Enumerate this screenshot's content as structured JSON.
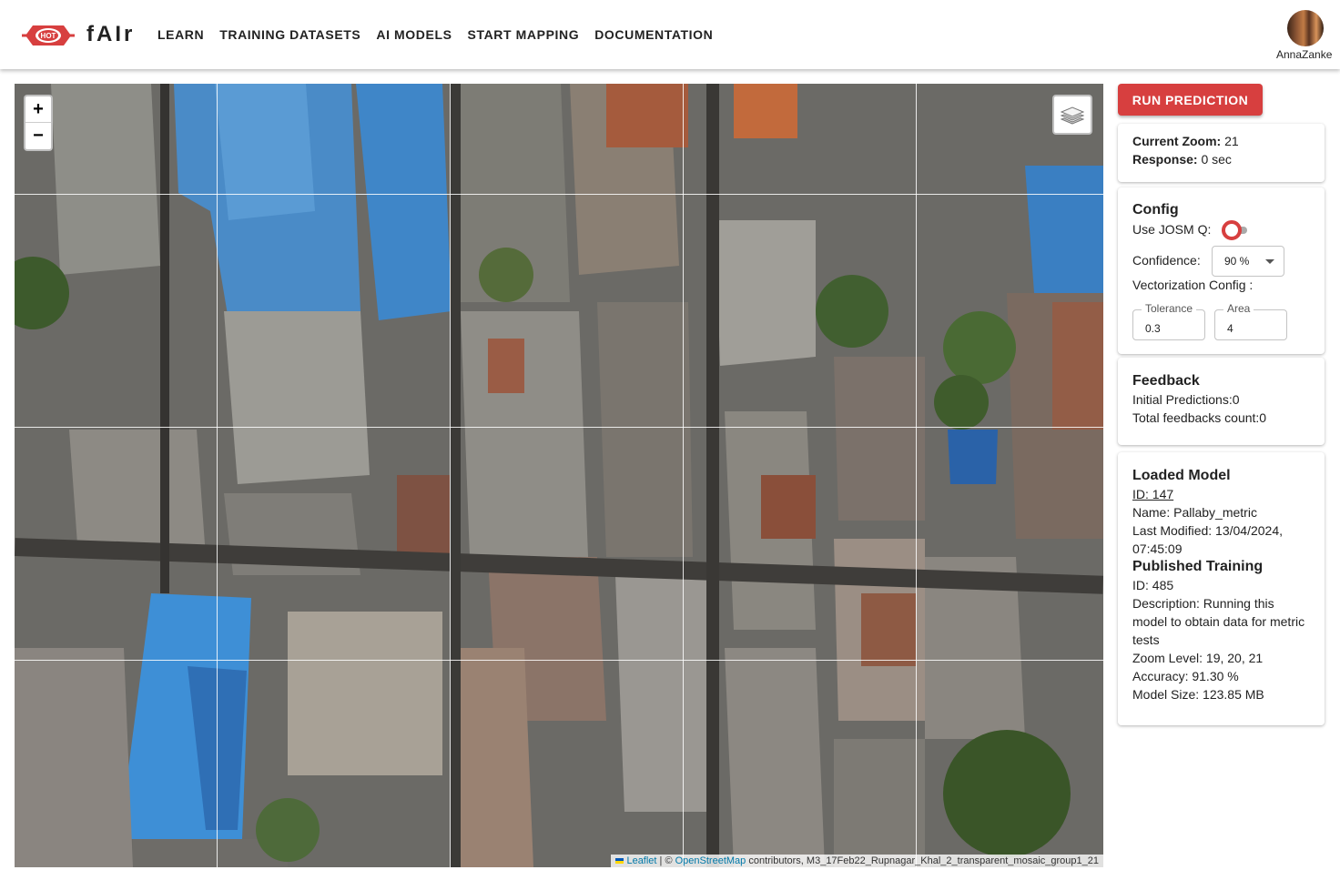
{
  "header": {
    "logo_text": "HOT",
    "brand": "fAIr",
    "nav": [
      "LEARN",
      "TRAINING DATASETS",
      "AI MODELS",
      "START MAPPING",
      "DOCUMENTATION"
    ],
    "username": "AnnaZanke"
  },
  "map": {
    "zoom_in": "+",
    "zoom_out": "−",
    "attribution": {
      "leaflet": "Leaflet",
      "sep": " | © ",
      "osm": "OpenStreetMap",
      "rest": " contributors, M3_17Feb22_Rupnagar_Khal_2_transparent_mosaic_group1_21"
    }
  },
  "panel": {
    "run_button": "RUN PREDICTION",
    "status": {
      "zoom_label": "Current Zoom:",
      "zoom_value": " 21",
      "response_label": "Response:",
      "response_value": " 0 sec"
    },
    "config": {
      "title": "Config",
      "josm_label": "Use JOSM Q:",
      "josm_enabled": false,
      "confidence_label": "Confidence:",
      "confidence_value": "90 %",
      "vectorization_label": "Vectorization Config :",
      "tolerance_label": "Tolerance",
      "tolerance_value": "0.3",
      "area_label": "Area",
      "area_value": "4"
    },
    "feedback": {
      "title": "Feedback",
      "initial": "Initial Predictions:0",
      "total": "Total feedbacks count:0"
    },
    "model": {
      "title": "Loaded Model",
      "id": "ID: 147",
      "name": "Name: Pallaby_metric",
      "modified_1": "Last Modified: 13/04/2024,",
      "modified_2": "07:45:09",
      "training_title": "Published Training",
      "training_id": "ID: 485",
      "desc_1": "Description: Running this",
      "desc_2": "model to obtain data for metric",
      "desc_3": "tests",
      "zoom": "Zoom Level: 19, 20, 21",
      "accuracy": "Accuracy: 91.30 %",
      "size": "Model Size: 123.85 MB"
    }
  },
  "colors": {
    "accent": "#d73f3f"
  }
}
